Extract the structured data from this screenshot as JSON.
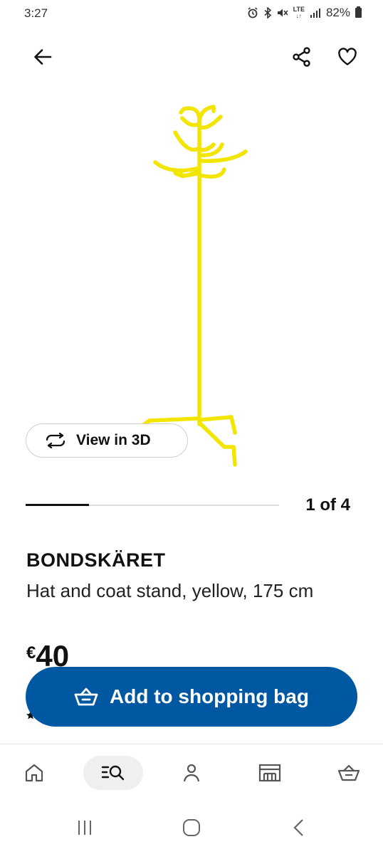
{
  "status_bar": {
    "time": "3:27",
    "network": "LTE",
    "battery": "82%"
  },
  "top_bar": {
    "back_icon": "arrow-left-icon",
    "share_icon": "share-icon",
    "favorite_icon": "heart-icon"
  },
  "product": {
    "name": "BONDSKÄRET",
    "description": "Hat and coat stand, yellow, 175 cm",
    "price_currency": "€",
    "price_amount": "40",
    "image_color": "#f2e500"
  },
  "gallery": {
    "view_3d_label": "View in 3D",
    "pager_label": "1 of 4",
    "current": 1,
    "total": 4
  },
  "actions": {
    "add_to_bag_label": "Add to shopping bag",
    "accent_color": "#0058a3"
  },
  "bottom_nav": {
    "items": [
      {
        "icon": "home-icon",
        "active": false
      },
      {
        "icon": "search-list-icon",
        "active": true
      },
      {
        "icon": "profile-icon",
        "active": false
      },
      {
        "icon": "store-icon",
        "active": false
      },
      {
        "icon": "basket-icon",
        "active": false
      }
    ]
  },
  "system_nav": {
    "recents_icon": "recents-icon",
    "home_icon": "home-circle-icon",
    "back_icon": "back-chevron-icon"
  }
}
